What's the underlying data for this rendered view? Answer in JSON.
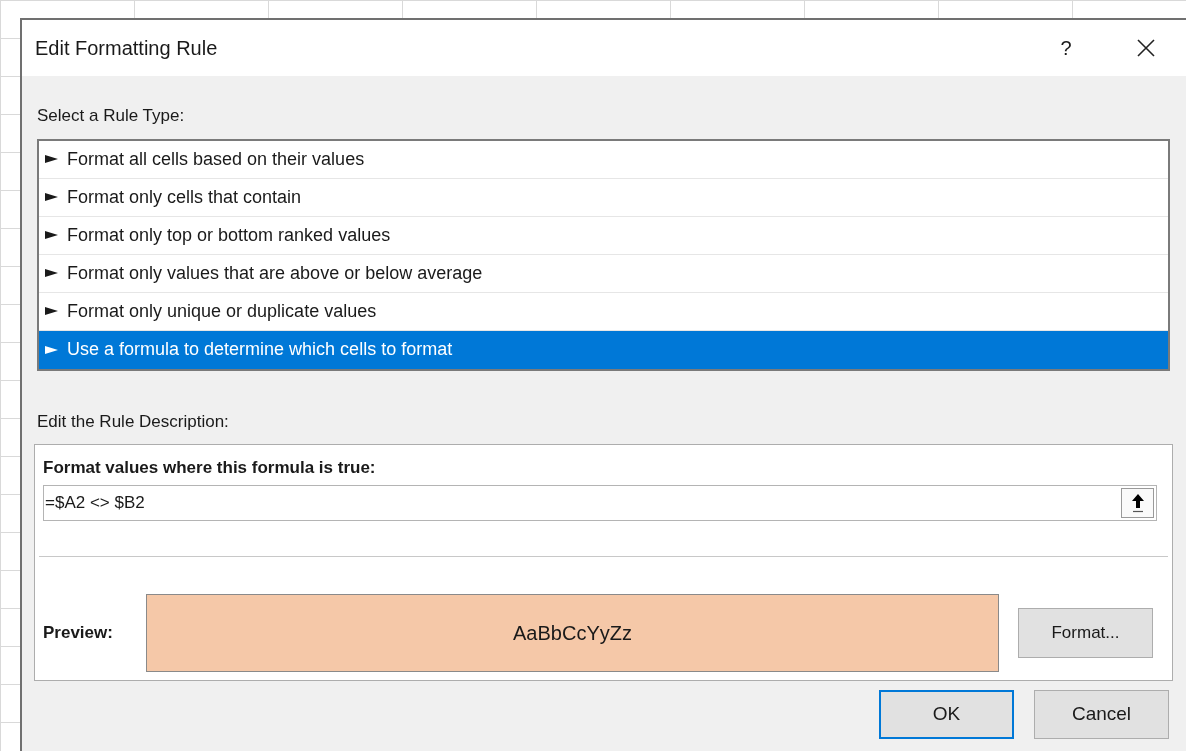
{
  "dialog": {
    "title": "Edit Formatting Rule",
    "help_button": "?"
  },
  "rule_type": {
    "label": "Select a Rule Type:",
    "items": [
      {
        "label": "Format all cells based on their values",
        "selected": false
      },
      {
        "label": "Format only cells that contain",
        "selected": false
      },
      {
        "label": "Format only top or bottom ranked values",
        "selected": false
      },
      {
        "label": "Format only values that are above or below average",
        "selected": false
      },
      {
        "label": "Format only unique or duplicate values",
        "selected": false
      },
      {
        "label": "Use a formula to determine which cells to format",
        "selected": true
      }
    ]
  },
  "description": {
    "label": "Edit the Rule Description:",
    "formula_label": "Format values where this formula is true:",
    "formula": "=$A2 <> $B2",
    "preview_label": "Preview:",
    "preview_text": "AaBbCcYyZz",
    "format_button": "Format..."
  },
  "buttons": [
    {
      "label": "OK",
      "focused": true
    },
    {
      "label": "Cancel",
      "focused": false
    }
  ]
}
